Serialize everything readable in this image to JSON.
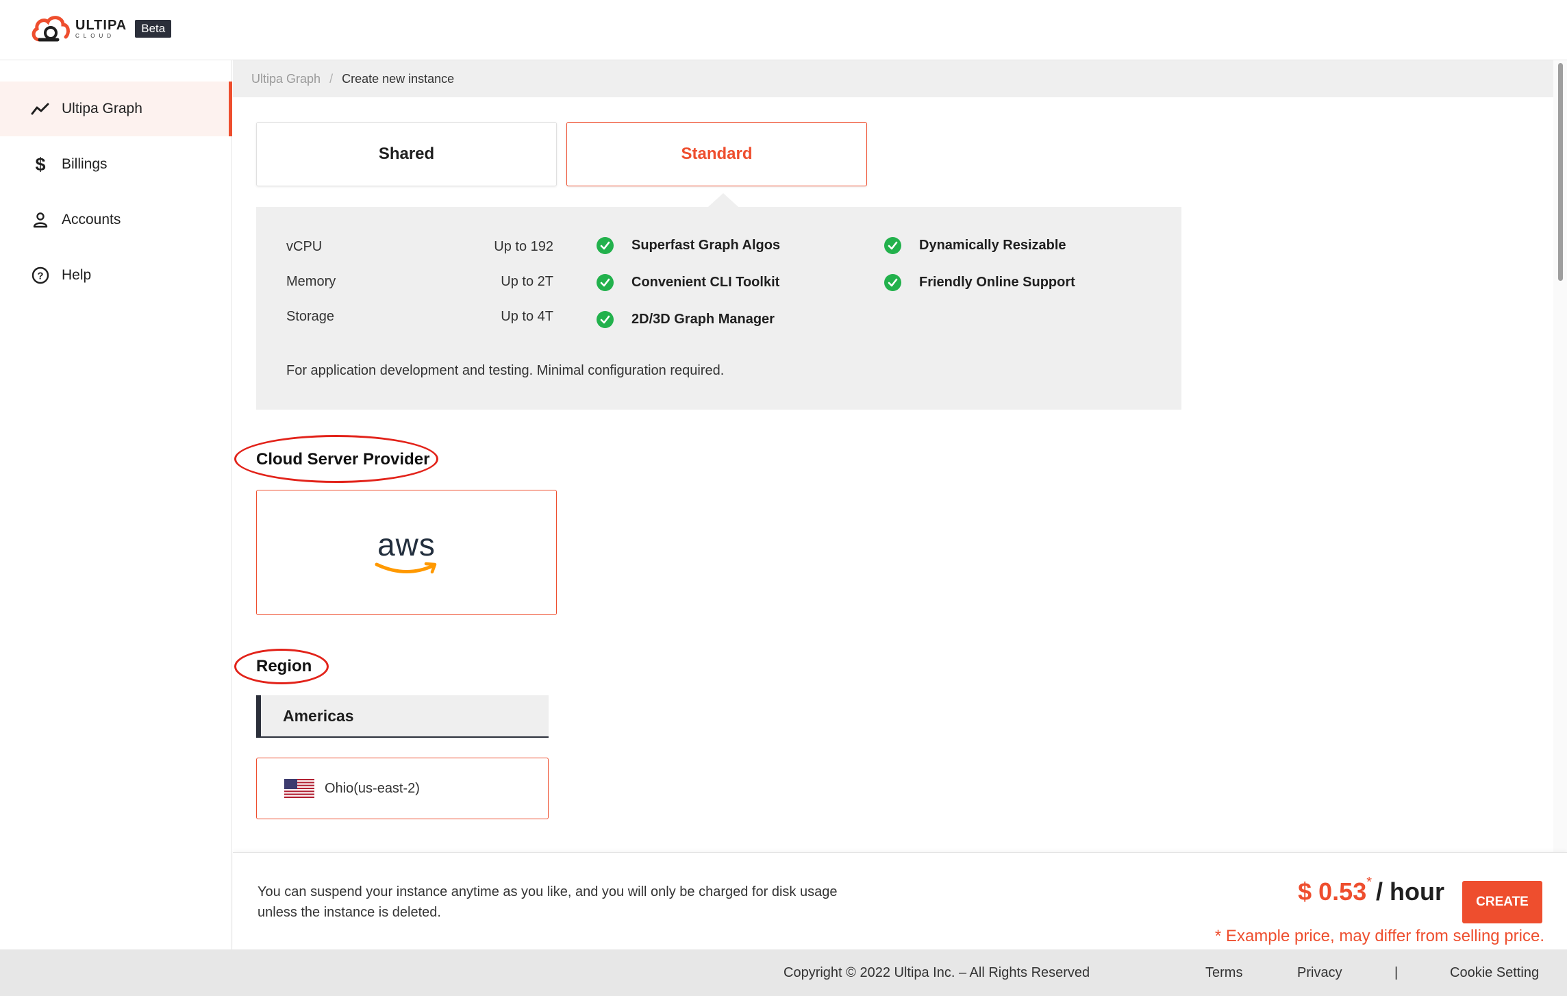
{
  "brand": {
    "logo_word": "ULTIPA",
    "logo_sub": "CLOUD",
    "badge": "Beta",
    "accent": "#ee4e2e"
  },
  "sidebar": {
    "items": [
      {
        "label": "Ultipa Graph",
        "icon": "trend-line-icon",
        "active": true
      },
      {
        "label": "Billings",
        "icon": "dollar-icon",
        "active": false
      },
      {
        "label": "Accounts",
        "icon": "user-icon",
        "active": false
      },
      {
        "label": "Help",
        "icon": "question-circle-icon",
        "active": false
      }
    ]
  },
  "breadcrumb": {
    "parent": "Ultipa Graph",
    "separator": "/",
    "current": "Create new instance"
  },
  "tiers": {
    "shared": "Shared",
    "standard": "Standard",
    "selected": "Standard"
  },
  "specs": {
    "rows": [
      {
        "label": "vCPU",
        "value": "Up to 192"
      },
      {
        "label": "Memory",
        "value": "Up to 2T"
      },
      {
        "label": "Storage",
        "value": "Up to 4T"
      }
    ],
    "features": [
      "Superfast Graph Algos",
      "Convenient CLI Toolkit",
      "2D/3D Graph Manager",
      "Dynamically Resizable",
      "Friendly Online Support"
    ],
    "description": "For application development and testing. Minimal configuration required."
  },
  "provider": {
    "title": "Cloud Server Provider",
    "selected": "aws"
  },
  "region": {
    "title": "Region",
    "group": "Americas",
    "selected": "Ohio(us-east-2)"
  },
  "bottom": {
    "note": "You can suspend your instance anytime as you like, and you will only be charged for disk usage unless the instance is deleted.",
    "price": "$ 0.53",
    "price_star": "*",
    "price_unit": "/ hour",
    "create_label": "CREATE",
    "disclaimer": "* Example price, may differ from selling price."
  },
  "footer": {
    "copyright": "Copyright © 2022 Ultipa Inc. – All Rights Reserved",
    "terms": "Terms",
    "privacy": "Privacy",
    "divider": "|",
    "cookie": "Cookie Setting"
  }
}
